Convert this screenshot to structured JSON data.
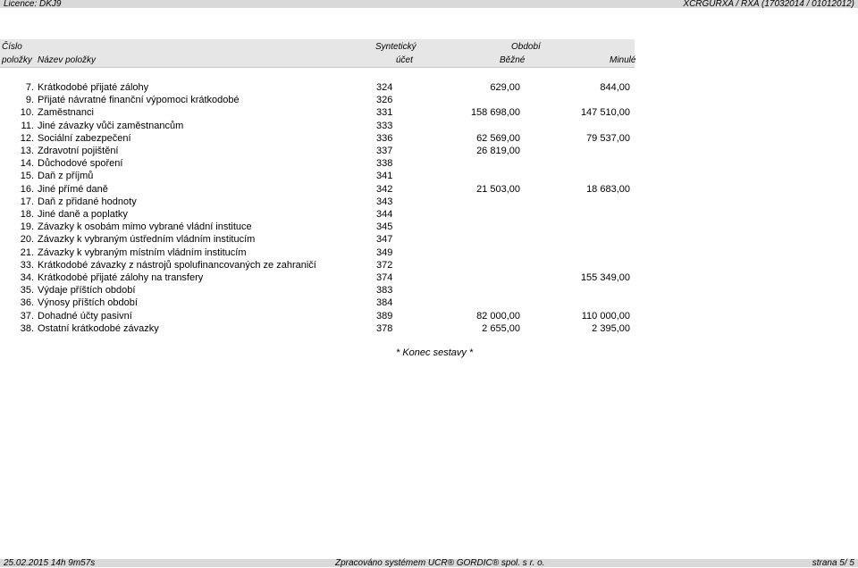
{
  "topbar": {
    "licence": "Licence: DKJ9",
    "report": "XCRGURXA / RXA   (17032014 / 01012012)"
  },
  "columns": {
    "cislo_top": "Číslo",
    "cislo_bottom": "položky",
    "nazev": "Název položky",
    "synteticky_top": "Syntetický",
    "synteticky_bottom": "účet",
    "obdobi": "Období",
    "bezne": "Běžné",
    "minule": "Minulé"
  },
  "rows": [
    {
      "num": "7.",
      "name": "Krátkodobé přijaté zálohy",
      "acc": "324",
      "bezne": "629,00",
      "minule": "844,00"
    },
    {
      "num": "9.",
      "name": "Přijaté návratné finanční výpomoci krátkodobé",
      "acc": "326",
      "bezne": "",
      "minule": ""
    },
    {
      "num": "10.",
      "name": "Zaměstnanci",
      "acc": "331",
      "bezne": "158 698,00",
      "minule": "147 510,00"
    },
    {
      "num": "11.",
      "name": "Jiné závazky vůči zaměstnancům",
      "acc": "333",
      "bezne": "",
      "minule": ""
    },
    {
      "num": "12.",
      "name": "Sociální zabezpečení",
      "acc": "336",
      "bezne": "62 569,00",
      "minule": "79 537,00"
    },
    {
      "num": "13.",
      "name": "Zdravotní pojištění",
      "acc": "337",
      "bezne": "26 819,00",
      "minule": ""
    },
    {
      "num": "14.",
      "name": "Důchodové spoření",
      "acc": "338",
      "bezne": "",
      "minule": ""
    },
    {
      "num": "15.",
      "name": "Daň z příjmů",
      "acc": "341",
      "bezne": "",
      "minule": ""
    },
    {
      "num": "16.",
      "name": "Jiné přímé daně",
      "acc": "342",
      "bezne": "21 503,00",
      "minule": "18 683,00"
    },
    {
      "num": "17.",
      "name": "Daň z přidané hodnoty",
      "acc": "343",
      "bezne": "",
      "minule": ""
    },
    {
      "num": "18.",
      "name": "Jiné daně a poplatky",
      "acc": "344",
      "bezne": "",
      "minule": ""
    },
    {
      "num": "19.",
      "name": "Závazky k osobám mimo vybrané vládní instituce",
      "acc": "345",
      "bezne": "",
      "minule": ""
    },
    {
      "num": "20.",
      "name": "Závazky k vybraným ústředním vládním institucím",
      "acc": "347",
      "bezne": "",
      "minule": ""
    },
    {
      "num": "21.",
      "name": "Závazky k vybraným místním vládním institucím",
      "acc": "349",
      "bezne": "",
      "minule": ""
    },
    {
      "num": "33.",
      "name": "Krátkodobé závazky z nástrojů spolufinancovaných ze zahraničí",
      "acc": "372",
      "bezne": "",
      "minule": ""
    },
    {
      "num": "34.",
      "name": "Krátkodobé přijaté zálohy na transfery",
      "acc": "374",
      "bezne": "",
      "minule": "155 349,00"
    },
    {
      "num": "35.",
      "name": "Výdaje příštích období",
      "acc": "383",
      "bezne": "",
      "minule": ""
    },
    {
      "num": "36.",
      "name": "Výnosy příštích období",
      "acc": "384",
      "bezne": "",
      "minule": ""
    },
    {
      "num": "37.",
      "name": "Dohadné účty pasivní",
      "acc": "389",
      "bezne": "82 000,00",
      "minule": "110 000,00"
    },
    {
      "num": "38.",
      "name": "Ostatní krátkodobé závazky",
      "acc": "378",
      "bezne": "2 655,00",
      "minule": "2 395,00"
    }
  ],
  "end_note": "* Konec sestavy *",
  "footer": {
    "date": "25.02.2015 14h 9m57s",
    "system": "Zpracováno systémem   UCR® GORDIC® spol. s   r. o.",
    "page": "strana  5/ 5"
  }
}
